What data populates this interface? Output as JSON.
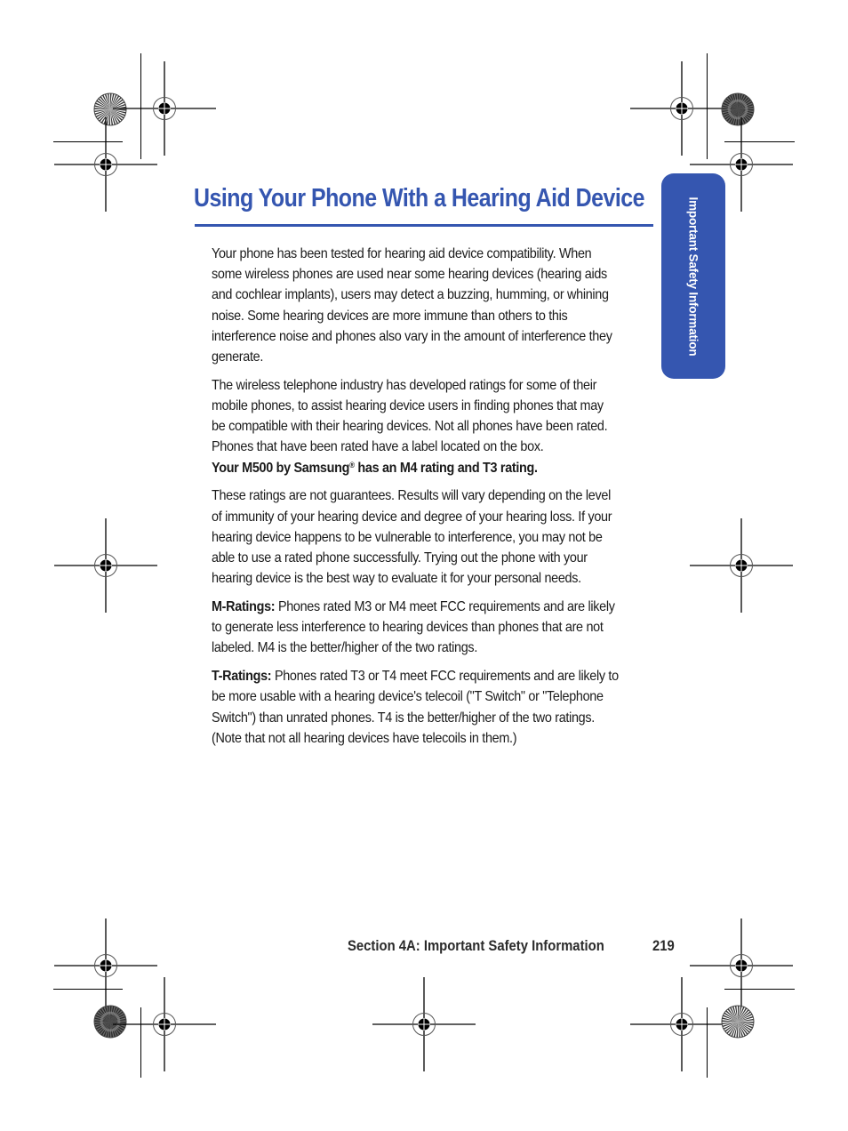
{
  "theme": {
    "accent": "#3556b0"
  },
  "page": {
    "title": "Using Your Phone With a Hearing Aid Device",
    "side_tab": "Important Safety Information",
    "paragraphs": [
      {
        "lines": [
          "Your phone has been tested for hearing aid device compatibility. When",
          "some wireless phones are used near some hearing devices (hearing aids",
          "and cochlear implants), users may detect a buzzing, humming, or whining",
          "noise. Some hearing devices are more immune than others to this",
          "interference noise and phones also vary in the amount of interference they",
          "generate."
        ]
      },
      {
        "lines": [
          "The wireless telephone industry has developed ratings for some of their",
          "mobile phones, to assist hearing device users in finding phones that may",
          "be compatible with their hearing devices. Not all phones have been rated.",
          "Phones that have been rated have a label located on the box."
        ],
        "bold_line_prefix": "Your M500 by Samsung",
        "bold_line_reg": "®",
        "bold_line_suffix": " has an M4 rating and T3 rating."
      },
      {
        "lines": [
          "These ratings are not guarantees.  Results will vary depending on the level",
          "of immunity of your hearing device and degree of your hearing loss.  If your",
          "hearing device happens to be vulnerable to interference, you may not be",
          "able to use a rated phone successfully.  Trying out the phone with your",
          "hearing device is the best way to evaluate it for your personal needs."
        ]
      },
      {
        "lead": "M-Ratings:",
        "lines": [
          " Phones rated M3 or M4 meet FCC requirements and are likely",
          "to generate less interference to hearing devices than phones that are not",
          "labeled. M4 is the better/higher of the two ratings."
        ]
      },
      {
        "lead": "T-Ratings:",
        "lines": [
          " Phones rated T3 or T4 meet FCC requirements and are likely to",
          "be more usable with a hearing device's telecoil (\"T Switch\" or \"Telephone",
          "Switch\") than unrated phones. T4 is the better/higher of the two ratings.",
          "(Note that not all hearing devices have telecoils in them.)"
        ]
      }
    ],
    "footer": {
      "section": "Section 4A: Important Safety Information",
      "page_number": "219"
    }
  },
  "print_marks": {
    "registration_icon": "crosshair-target-icon",
    "color_bar_icon": "starburst-icon"
  }
}
